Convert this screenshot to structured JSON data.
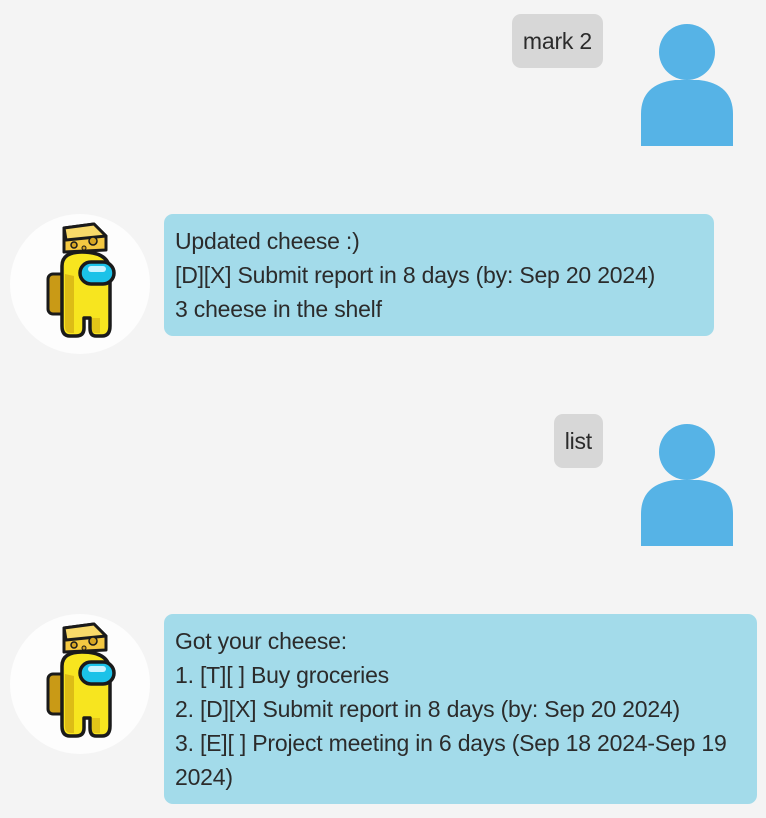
{
  "colors": {
    "background": "#f4f4f4",
    "user_bubble": "#d7d7d7",
    "bot_bubble": "#a3dbea",
    "user_avatar": "#56b3e6",
    "bot_avatar_body": "#f7e51f",
    "cheese": "#f4c842"
  },
  "messages": [
    {
      "sender": "user",
      "avatar_icon": "user-silhouette-icon",
      "text": "mark 2"
    },
    {
      "sender": "bot",
      "avatar_icon": "crewmate-cheese-icon",
      "lines": [
        "Updated cheese :)",
        "[D][X] Submit report in 8 days (by: Sep 20 2024)",
        "3 cheese in the shelf"
      ]
    },
    {
      "sender": "user",
      "avatar_icon": "user-silhouette-icon",
      "text": "list"
    },
    {
      "sender": "bot",
      "avatar_icon": "crewmate-cheese-icon",
      "lines": [
        "Got your cheese:",
        "1. [T][ ] Buy groceries",
        "2. [D][X] Submit report in 8 days (by: Sep 20 2024)",
        "3. [E][ ] Project meeting in 6 days (Sep 18 2024-Sep 19 2024)"
      ]
    }
  ]
}
